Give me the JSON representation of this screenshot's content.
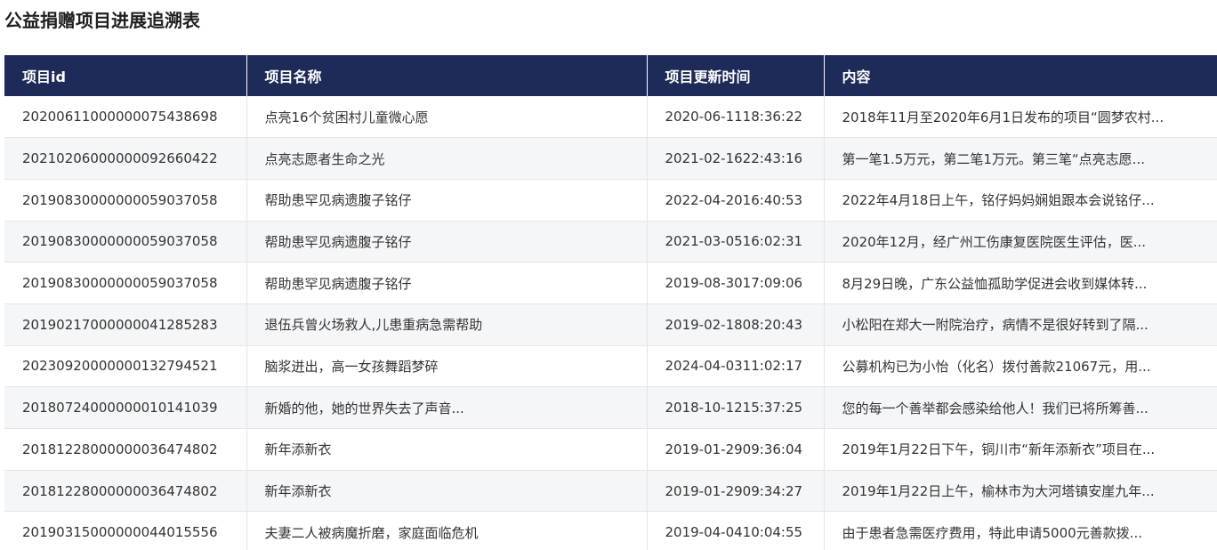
{
  "page": {
    "title": "公益捐赠项目进展追溯表"
  },
  "table": {
    "headers": [
      "项目id",
      "项目名称",
      "项目更新时间",
      "内容"
    ],
    "rows": [
      [
        "20200611000000075438698",
        "点亮16个贫困村儿童微心愿",
        "2020-06-1118:36:22",
        "2018年11月至2020年6月1日发布的项目“圆梦农村..."
      ],
      [
        "20210206000000092660422",
        "点亮志愿者生命之光",
        "2021-02-1622:43:16",
        "第一笔1.5万元，第二笔1万元。第三笔“点亮志愿..."
      ],
      [
        "20190830000000059037058",
        "帮助患罕见病遗腹子铭仔",
        "2022-04-2016:40:53",
        "2022年4月18日上午，铭仔妈妈娴姐跟本会说铭仔..."
      ],
      [
        "20190830000000059037058",
        "帮助患罕见病遗腹子铭仔",
        "2021-03-0516:02:31",
        "2020年12月，经广州工伤康复医院医生评估，医..."
      ],
      [
        "20190830000000059037058",
        "帮助患罕见病遗腹子铭仔",
        "2019-08-3017:09:06",
        "8月29日晚，广东公益恤孤助学促进会收到媒体转..."
      ],
      [
        "20190217000000041285283",
        "退伍兵曾火场救人,儿患重病急需帮助",
        "2019-02-1808:20:43",
        "小松阳在郑大一附院治疗，病情不是很好转到了隔..."
      ],
      [
        "20230920000000132794521",
        "脑浆迸出，高一女孩舞蹈梦碎",
        "2024-04-0311:02:17",
        "公募机构已为小怡（化名）拨付善款21067元，用..."
      ],
      [
        "20180724000000010141039",
        "新婚的他，她的世界失去了声音...",
        "2018-10-1215:37:25",
        "您的每一个善举都会感染给他人！我们已将所筹善..."
      ],
      [
        "20181228000000036474802",
        "新年添新衣",
        "2019-01-2909:36:04",
        "2019年1月22日下午，铜川市“新年添新衣”项目在..."
      ],
      [
        "20181228000000036474802",
        "新年添新衣",
        "2019-01-2909:34:27",
        "2019年1月22日上午，榆林市为大河塔镇安崖九年..."
      ],
      [
        "20190315000000044015556",
        "夫妻二人被病魔折磨，家庭面临危机",
        "2019-04-0410:04:55",
        "由于患者急需医疗费用，特此申请5000元善款拨..."
      ]
    ]
  },
  "colors": {
    "header_bg": "#1e2a58",
    "header_text": "#ffffff",
    "row_alt_bg": "#f5f6f8",
    "text": "#333333"
  }
}
